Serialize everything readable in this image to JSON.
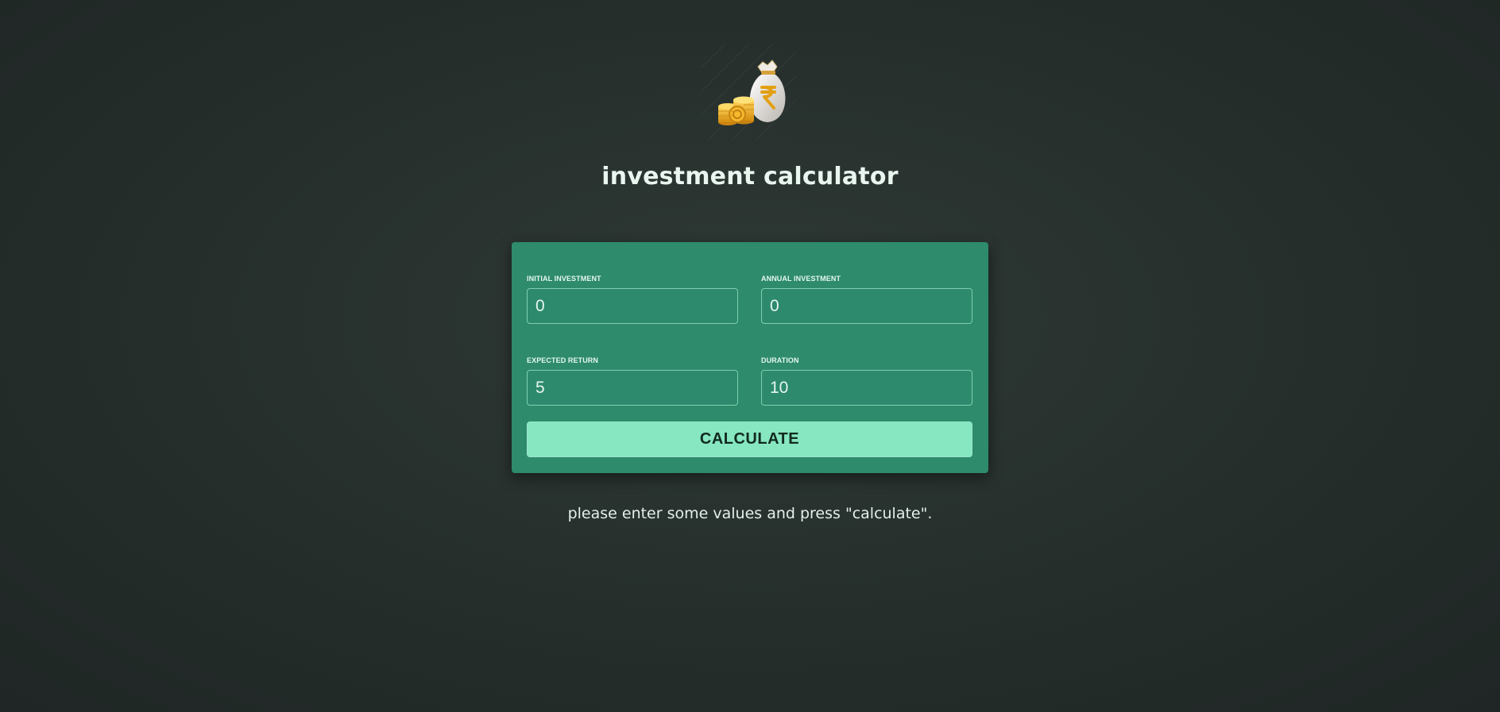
{
  "header": {
    "logo_icon": "rupee-money-bag-coins-icon",
    "title": "investment calculator"
  },
  "form": {
    "initial_investment": {
      "label": "INITIAL INVESTMENT",
      "value": "0"
    },
    "annual_investment": {
      "label": "ANNUAL INVESTMENT",
      "value": "0"
    },
    "expected_return": {
      "label": "EXPECTED RETURN",
      "value": "5"
    },
    "duration": {
      "label": "DURATION",
      "value": "10"
    },
    "calculate_label": "CALCULATE"
  },
  "status": {
    "message": "please enter some values and press \"calculate\"."
  },
  "colors": {
    "background": "#252d2b",
    "card": "#2e8b6c",
    "button": "#86e7c1",
    "text": "#e6f3ee"
  }
}
